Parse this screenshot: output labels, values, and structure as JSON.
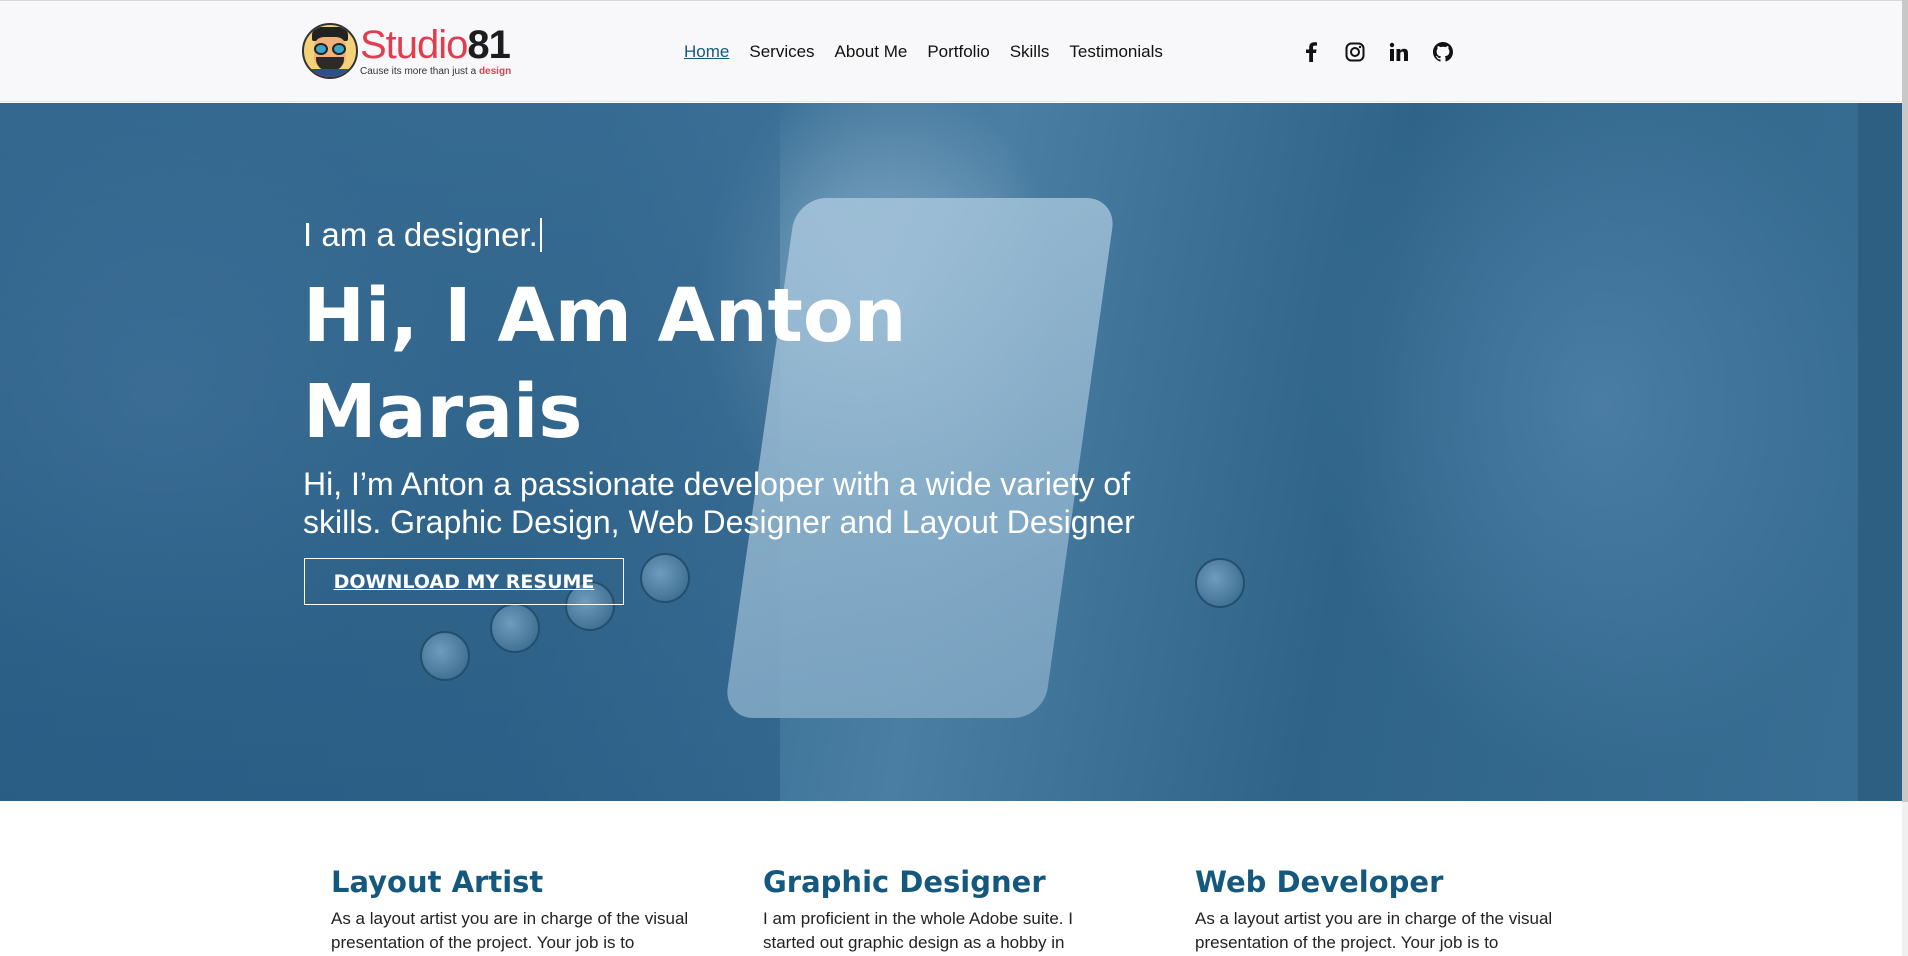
{
  "brand": {
    "name_part1": "Studio",
    "name_part2": "81",
    "tagline_prefix": "Cause its more than just a ",
    "tagline_highlight": "design",
    "mascot_icon": "bearded-glasses-mascot-icon",
    "accent_color": "#e23d4f"
  },
  "nav": {
    "items": [
      {
        "label": "Home",
        "active": true
      },
      {
        "label": "Services",
        "active": false
      },
      {
        "label": "About Me",
        "active": false
      },
      {
        "label": "Portfolio",
        "active": false
      },
      {
        "label": "Skills",
        "active": false
      },
      {
        "label": "Testimonials",
        "active": false
      }
    ],
    "active_color": "#14597d"
  },
  "social": [
    {
      "icon": "facebook-icon"
    },
    {
      "icon": "instagram-icon"
    },
    {
      "icon": "linkedin-icon"
    },
    {
      "icon": "github-icon"
    }
  ],
  "hero": {
    "typed_text": "I am a designer.",
    "title": "Hi, I Am Anton Marais",
    "description": "Hi, I’m Anton a passionate developer with a wide variety of skills. Graphic Design, Web Designer and Layout Designer",
    "button_label": "DOWNLOAD MY RESUME",
    "overlay_color": "#2b6186"
  },
  "services": [
    {
      "title": "Layout Artist",
      "text": "As a layout artist you are in charge of the visual presentation of the project. Your job is to"
    },
    {
      "title": "Graphic Designer",
      "text": "I am proficient in the whole Adobe suite. I started out graphic design as a hobby in photoshop"
    },
    {
      "title": "Web Developer",
      "text": "As a layout artist you are in charge of the visual presentation of the project. Your job is to"
    }
  ]
}
